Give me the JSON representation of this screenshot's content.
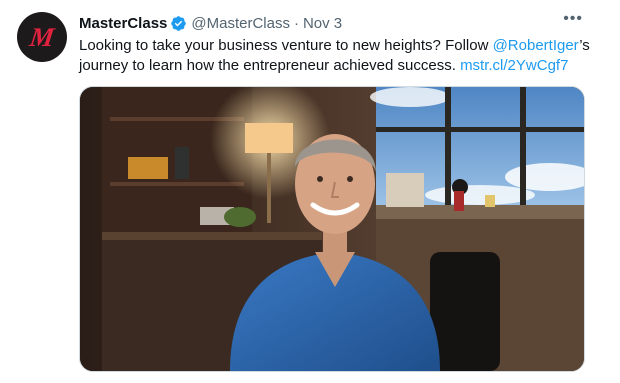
{
  "tweet": {
    "author_name": "MasterClass",
    "handle": "@MasterClass",
    "separator": "·",
    "date": "Nov 3",
    "more_icon": "more-horizontal-icon",
    "verified_icon": "verified-badge-icon",
    "avatar_text": "M",
    "text_line1_prefix": "Looking to take your business venture to new heights? Follow ",
    "mention": "@RobertIger",
    "text_line1_suffix": "’s",
    "text_line2": "journey to learn how the entrepreneur achieved success. ",
    "link": "mstr.cl/2YwCgf7",
    "colors": {
      "link": "#1d9bf0",
      "verified": "#1d9bf0",
      "avatar_bg": "#1d1a1c",
      "avatar_logo": "#e0223f"
    }
  }
}
